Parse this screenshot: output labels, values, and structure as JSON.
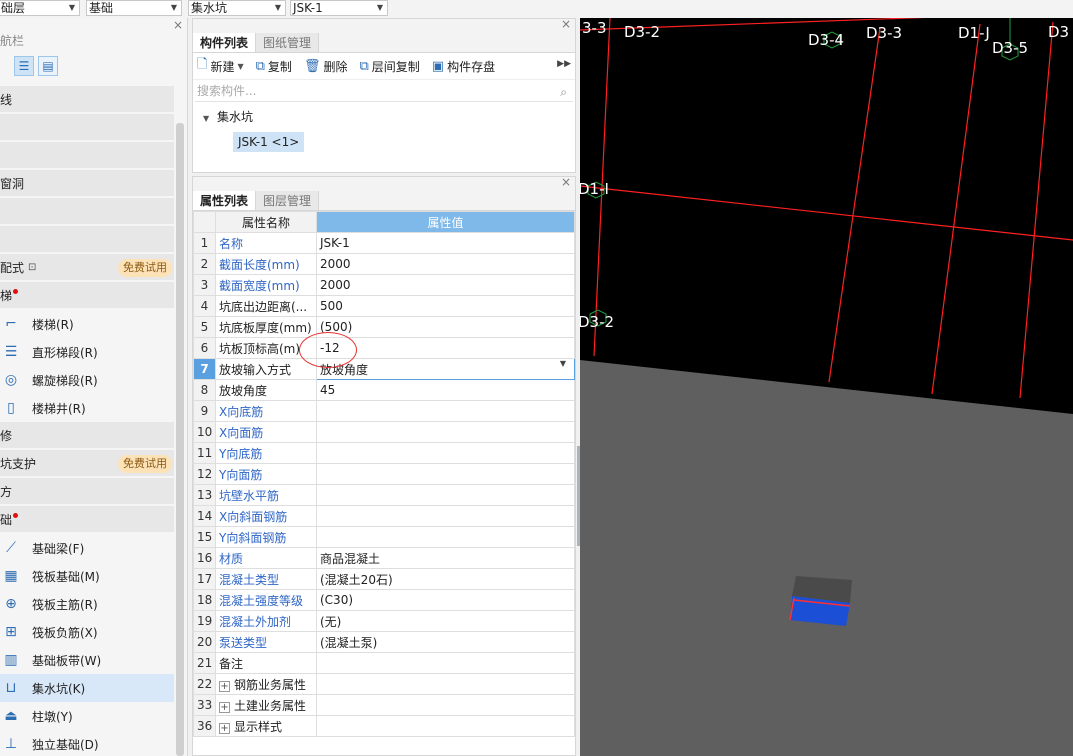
{
  "topbar": {
    "floor_select": "础层",
    "category_select": "基础",
    "type_select": "集水坑",
    "component_select": "JSK-1"
  },
  "nav": {
    "title": "导航栏",
    "items": [
      {
        "label": "线",
        "kind": "cat"
      },
      {
        "label": "",
        "kind": "cat"
      },
      {
        "label": "",
        "kind": "cat"
      },
      {
        "label": "窗洞",
        "kind": "cat"
      },
      {
        "label": "",
        "kind": "cat"
      },
      {
        "label": "",
        "kind": "cat"
      },
      {
        "label": "配式",
        "kind": "cat",
        "lock": true,
        "badge": "免费试用"
      },
      {
        "label": "梯",
        "kind": "cat",
        "dot": true
      },
      {
        "label": "楼梯(R)",
        "kind": "item",
        "icon": "stair-icon"
      },
      {
        "label": "直形梯段(R)",
        "kind": "item",
        "icon": "straight-stair-icon"
      },
      {
        "label": "螺旋梯段(R)",
        "kind": "item",
        "icon": "spiral-stair-icon"
      },
      {
        "label": "楼梯井(R)",
        "kind": "item",
        "icon": "stairwell-icon"
      },
      {
        "label": "修",
        "kind": "cat"
      },
      {
        "label": "坑支护",
        "kind": "cat",
        "badge": "免费试用"
      },
      {
        "label": "方",
        "kind": "cat"
      },
      {
        "label": "础",
        "kind": "cat",
        "dot": true
      },
      {
        "label": "基础梁(F)",
        "kind": "item",
        "icon": "foundation-beam-icon"
      },
      {
        "label": "筏板基础(M)",
        "kind": "item",
        "icon": "raft-foundation-icon"
      },
      {
        "label": "筏板主筋(R)",
        "kind": "item",
        "icon": "raft-main-rebar-icon"
      },
      {
        "label": "筏板负筋(X)",
        "kind": "item",
        "icon": "raft-negative-rebar-icon"
      },
      {
        "label": "基础板带(W)",
        "kind": "item",
        "icon": "foundation-strip-icon"
      },
      {
        "label": "集水坑(K)",
        "kind": "item",
        "icon": "sump-pit-icon",
        "selected": true
      },
      {
        "label": "柱墩(Y)",
        "kind": "item",
        "icon": "column-pier-icon"
      },
      {
        "label": "独立基础(D)",
        "kind": "item",
        "icon": "isolated-foundation-icon"
      }
    ]
  },
  "component_panel": {
    "tabs": [
      "构件列表",
      "图纸管理"
    ],
    "toolbar": {
      "new": "新建",
      "copy": "复制",
      "delete": "删除",
      "floor_copy": "层间复制",
      "save": "构件存盘"
    },
    "search_placeholder": "搜索构件...",
    "tree_root": "集水坑",
    "tree_leaf": "JSK-1 <1>"
  },
  "property_panel": {
    "tabs": [
      "属性列表",
      "图层管理"
    ],
    "headers": {
      "name": "属性名称",
      "value": "属性值"
    },
    "rows": [
      {
        "num": "1",
        "name": "名称",
        "value": "JSK-1",
        "blue": true
      },
      {
        "num": "2",
        "name": "截面长度(mm)",
        "value": "2000",
        "blue": true
      },
      {
        "num": "3",
        "name": "截面宽度(mm)",
        "value": "2000",
        "blue": true
      },
      {
        "num": "4",
        "name": "坑底出边距离(...",
        "value": "500",
        "blue": false
      },
      {
        "num": "5",
        "name": "坑底板厚度(mm)",
        "value": "(500)",
        "blue": false
      },
      {
        "num": "6",
        "name": "坑板顶标高(m)",
        "value": "-12",
        "blue": false
      },
      {
        "num": "7",
        "name": "放坡输入方式",
        "value": "放坡角度",
        "blue": false,
        "selected": true
      },
      {
        "num": "8",
        "name": "放坡角度",
        "value": "45",
        "blue": false
      },
      {
        "num": "9",
        "name": "X向底筋",
        "value": "",
        "blue": true
      },
      {
        "num": "10",
        "name": "X向面筋",
        "value": "",
        "blue": true
      },
      {
        "num": "11",
        "name": "Y向底筋",
        "value": "",
        "blue": true
      },
      {
        "num": "12",
        "name": "Y向面筋",
        "value": "",
        "blue": true
      },
      {
        "num": "13",
        "name": "坑壁水平筋",
        "value": "",
        "blue": true
      },
      {
        "num": "14",
        "name": "X向斜面钢筋",
        "value": "",
        "blue": true
      },
      {
        "num": "15",
        "name": "Y向斜面钢筋",
        "value": "",
        "blue": true
      },
      {
        "num": "16",
        "name": "材质",
        "value": "商品混凝土",
        "blue": true
      },
      {
        "num": "17",
        "name": "混凝土类型",
        "value": "(混凝土20石)",
        "blue": true
      },
      {
        "num": "18",
        "name": "混凝土强度等级",
        "value": "(C30)",
        "blue": true
      },
      {
        "num": "19",
        "name": "混凝土外加剂",
        "value": "(无)",
        "blue": true
      },
      {
        "num": "20",
        "name": "泵送类型",
        "value": "(混凝土泵)",
        "blue": true
      },
      {
        "num": "21",
        "name": "备注",
        "value": "",
        "blue": false
      },
      {
        "num": "22",
        "name": "钢筋业务属性",
        "value": "",
        "blue": false,
        "expand": true
      },
      {
        "num": "33",
        "name": "土建业务属性",
        "value": "",
        "blue": false,
        "expand": true
      },
      {
        "num": "36",
        "name": "显示样式",
        "value": "",
        "blue": false,
        "expand": true
      }
    ]
  },
  "viewport": {
    "axis_labels": [
      "3-3",
      "D3-2",
      "D3-4",
      "D3-3",
      "D1-J",
      "D3-5",
      "D3",
      "D1-I",
      "D3-2"
    ],
    "grid_color": "#ff2020",
    "background": "#000000",
    "ground_color": "#5f5f5f"
  }
}
